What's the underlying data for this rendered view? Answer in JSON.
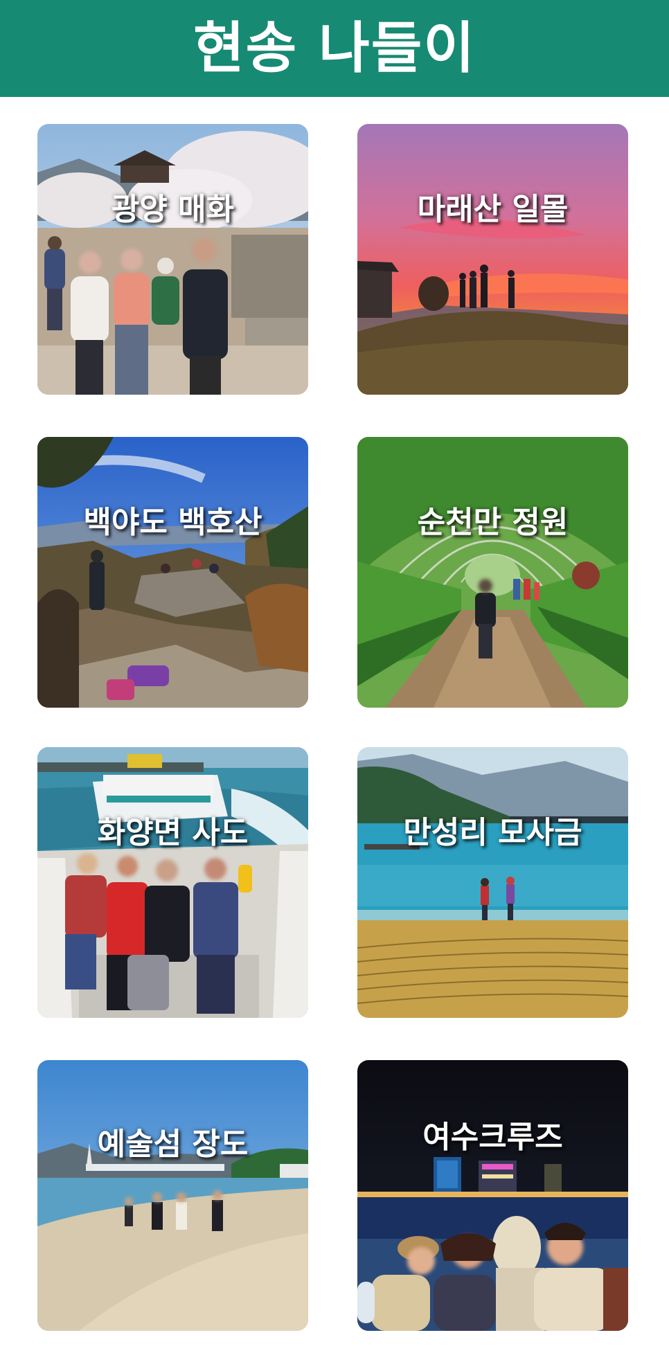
{
  "header": {
    "title": "현송 나들이",
    "color": "#168a72"
  },
  "cards": [
    {
      "label": "광양 매화",
      "photo_icon": "plum-blossom-group-photo"
    },
    {
      "label": "마래산 일몰",
      "photo_icon": "sunset-hill-photo"
    },
    {
      "label": "백야도 백호산",
      "photo_icon": "mountain-rock-photo"
    },
    {
      "label": "순천만 정원",
      "photo_icon": "garden-arch-path-photo"
    },
    {
      "label": "화양면 사도",
      "photo_icon": "boat-group-photo"
    },
    {
      "label": "만성리 모사금",
      "photo_icon": "beach-walk-photo"
    },
    {
      "label": "예술섬 장도",
      "photo_icon": "sand-bar-photo"
    },
    {
      "label": "여수크루즈",
      "photo_icon": "night-cruise-photo"
    }
  ]
}
